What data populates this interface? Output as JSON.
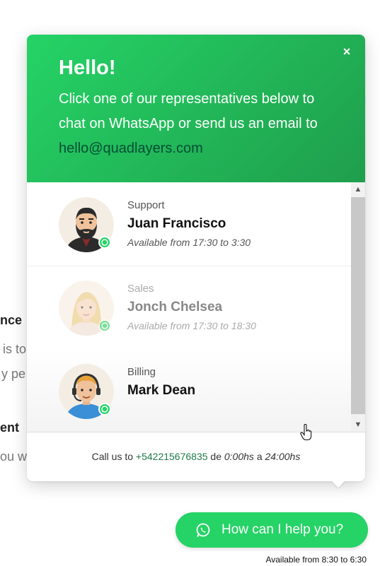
{
  "background": {
    "frag1": "nce",
    "frag2": "is to",
    "frag3": "y pe",
    "frag4": "ent",
    "frag5": "ou w"
  },
  "popup": {
    "title": "Hello!",
    "intro": "Click one of our representatives below to chat on WhatsApp or send us an email to",
    "email": "hello@quadlayers.com",
    "close_label": "×",
    "agents": [
      {
        "role": "Support",
        "name": "Juan Francisco",
        "availability": "Available from 17:30 to 3:30",
        "status": "online"
      },
      {
        "role": "Sales",
        "name": "Jonch Chelsea",
        "availability": "Available from 17:30 to 18:30",
        "status": "offline"
      },
      {
        "role": "Billing",
        "name": "Mark Dean",
        "availability": "",
        "status": "online"
      }
    ],
    "footer": {
      "prefix": "Call us to",
      "phone": "+542215676835",
      "connector": "de",
      "from": "0:00hs",
      "between": "a",
      "to": "24:00hs"
    }
  },
  "button": {
    "label": "How can I help you?",
    "icon": "whatsapp-icon"
  },
  "availability_note": "Available from 8:30 to 6:30",
  "colors": {
    "accent": "#25d366",
    "accent_dark": "#1f9e4c",
    "email": "#064e35"
  }
}
